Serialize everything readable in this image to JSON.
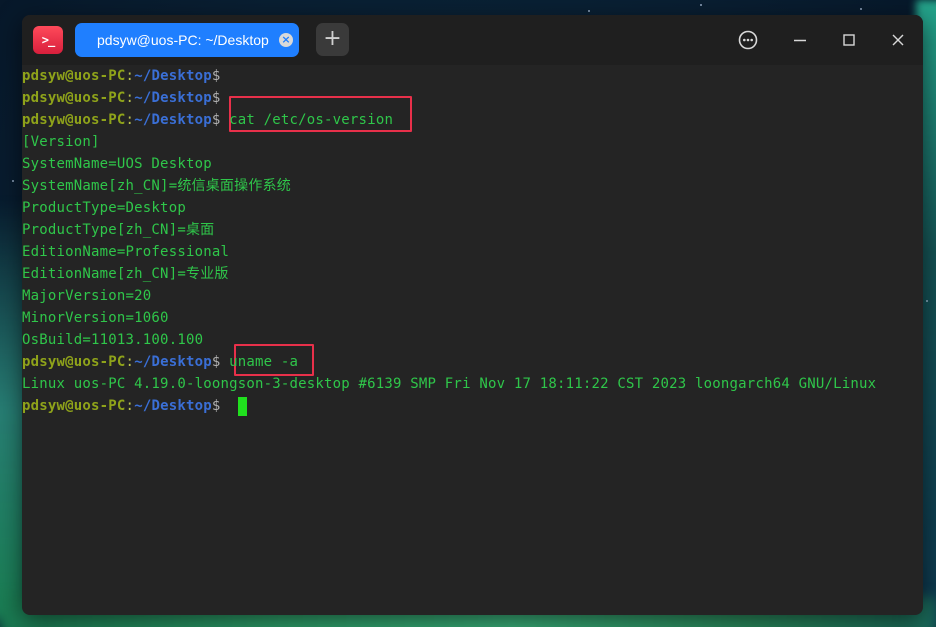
{
  "window": {
    "tab_title": "pdsyw@uos-PC: ~/Desktop",
    "app_icon_glyph": ">_",
    "new_tab_glyph": "+",
    "close_tab_glyph": "×"
  },
  "prompt": {
    "user_host": "pdsyw@uos-PC",
    "colon": ":",
    "path": "~/Desktop",
    "dollar": "$"
  },
  "terminal_lines": [
    {
      "type": "prompt",
      "command": ""
    },
    {
      "type": "prompt",
      "command": ""
    },
    {
      "type": "prompt",
      "command": " cat /etc/os-version"
    },
    {
      "type": "output",
      "text": "[Version]"
    },
    {
      "type": "output",
      "text": "SystemName=UOS Desktop"
    },
    {
      "type": "output",
      "text": "SystemName[zh_CN]=统信桌面操作系统"
    },
    {
      "type": "output",
      "text": "ProductType=Desktop"
    },
    {
      "type": "output",
      "text": "ProductType[zh_CN]=桌面"
    },
    {
      "type": "output",
      "text": "EditionName=Professional"
    },
    {
      "type": "output",
      "text": "EditionName[zh_CN]=专业版"
    },
    {
      "type": "output",
      "text": "MajorVersion=20"
    },
    {
      "type": "output",
      "text": "MinorVersion=1060"
    },
    {
      "type": "output",
      "text": "OsBuild=11013.100.100"
    },
    {
      "type": "prompt",
      "command": " uname -a"
    },
    {
      "type": "output",
      "text": "Linux uos-PC 4.19.0-loongson-3-desktop #6139 SMP Fri Nov 17 18:11:22 CST 2023 loongarch64 GNU/Linux"
    },
    {
      "type": "prompt",
      "command": " "
    }
  ],
  "colors": {
    "tab_active": "#1f7fff",
    "terminal_bg": "#242424",
    "output_green": "#2fc64a",
    "prompt_user": "#8fa31a",
    "prompt_path": "#3a6fd6",
    "highlight_red": "#e8304a",
    "cursor": "#20e01e"
  },
  "icons": {
    "app": "terminal-app-icon",
    "menu": "more-options-icon",
    "minimize": "minimize-icon",
    "maximize": "maximize-icon",
    "close": "close-icon"
  }
}
